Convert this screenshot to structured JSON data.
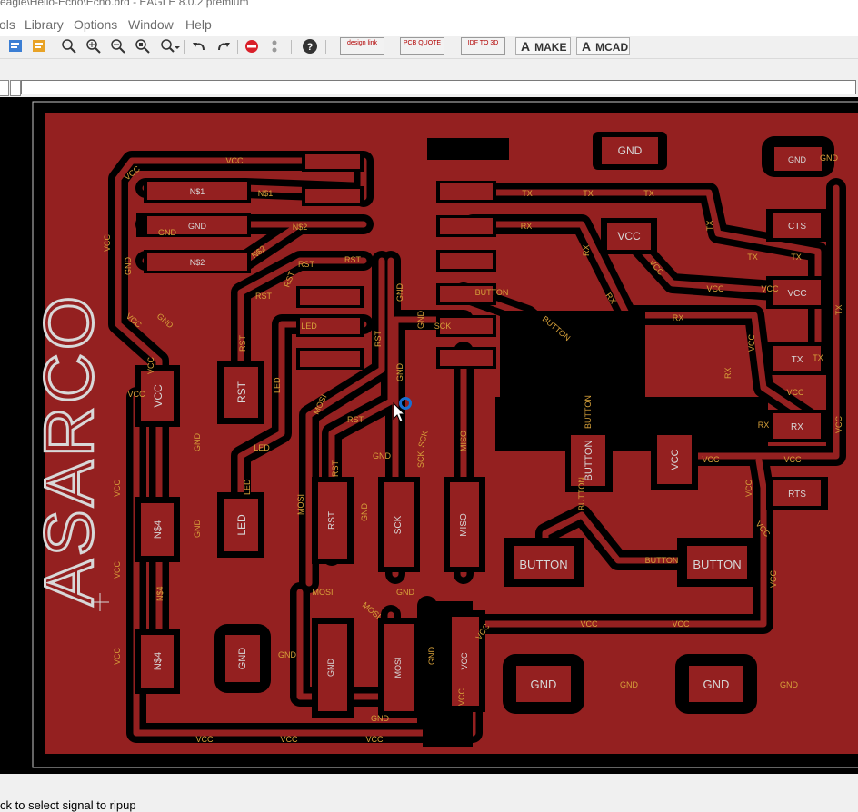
{
  "window": {
    "title": "eagle\\Hello-Echo\\Echo.brd - EAGLE 8.0.2 premium"
  },
  "menu": {
    "items": [
      "ols",
      "Library",
      "Options",
      "Window",
      "Help"
    ]
  },
  "toolbar": {
    "design_link": "design link",
    "pcb_quote": "PCB QUOTE",
    "idf_to_3d": "IDF TO 3D",
    "make": "MAKE",
    "mcad": "MCAD"
  },
  "command": {
    "value": ""
  },
  "board": {
    "logo": "ASARCO",
    "pads": {
      "gnd_tl": "GND",
      "gnd_tr": "GND",
      "vcc_mid": "VCC",
      "cts": "CTS",
      "vcc_r": "VCC",
      "tx_r": "TX",
      "rx_r": "RX",
      "rts": "RTS",
      "vcc_c": "VCC",
      "button_v": "BUTTON",
      "button1": "BUTTON",
      "button2": "BUTTON",
      "gnd_b1": "GND",
      "gnd_b2": "GND",
      "vcc_l": "VCC",
      "rst_l": "RST",
      "led_l": "LED",
      "n4a": "N$4",
      "n4b": "N$4",
      "gnd_bl": "GND",
      "rst_c": "RST",
      "sck_c": "SCK",
      "miso_c": "MISO",
      "gnd_s": "GND",
      "mosi_s": "MOSI",
      "vcc_s": "VCC",
      "n1": "N$1",
      "gnd_p": "GND",
      "n2": "N$2"
    },
    "nets": {
      "vcc": "VCC",
      "gnd": "GND",
      "n1": "N$1",
      "n2": "N$2",
      "n4": "N$4",
      "rst": "RST",
      "led": "LED",
      "mosi": "MOSI",
      "miso": "MISO",
      "sck": "SCK",
      "tx": "TX",
      "rx": "RX",
      "button": "BUTTON"
    }
  },
  "status": {
    "message": "ck to select signal to ripup"
  },
  "colors": {
    "copper": "#942020",
    "board_bg": "#000000",
    "label": "#d7a13a",
    "pad_label": "#d8d8d8",
    "cursor": "#1a6fd1"
  }
}
